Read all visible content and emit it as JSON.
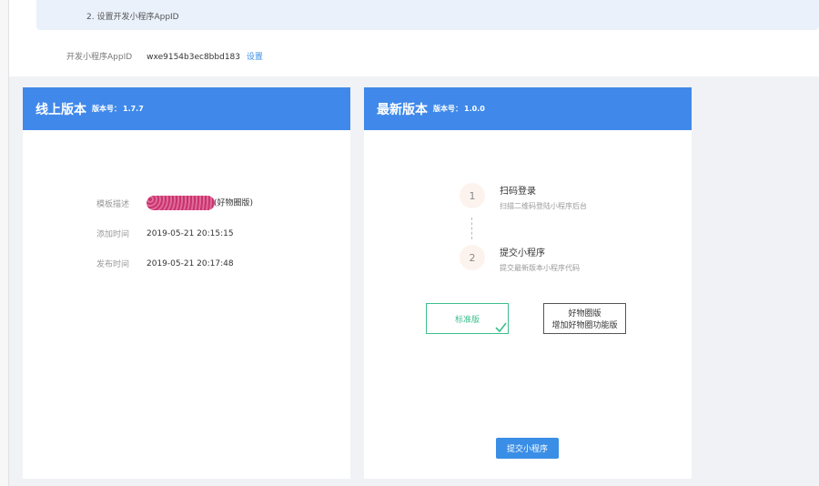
{
  "tip": {
    "text": "2. 设置开发小程序AppID"
  },
  "appid": {
    "label": "开发小程序AppID",
    "value": "wxe9154b3ec8bbd183",
    "link": "设置"
  },
  "online_card": {
    "title": "线上版本",
    "version_label": "版本号：",
    "version": "1.7.7",
    "rows": [
      {
        "label": "模板描述",
        "value": "(好物圈版)"
      },
      {
        "label": "添加时间",
        "value": "2019-05-21 20:15:15"
      },
      {
        "label": "发布时间",
        "value": "2019-05-21 20:17:48"
      }
    ]
  },
  "latest_card": {
    "title": "最新版本",
    "version_label": "版本号：",
    "version": "1.0.0",
    "steps": [
      {
        "number": "1",
        "title": "扫码登录",
        "desc": "扫描二维码登陆小程序后台"
      },
      {
        "number": "2",
        "title": "提交小程序",
        "desc": "提交最新版本小程序代码"
      }
    ],
    "versions": [
      {
        "name": "标准版",
        "desc": ""
      },
      {
        "name": "好物圈版",
        "desc": "增加好物圈功能版"
      }
    ],
    "submit_label": "提交小程序"
  },
  "colors": {
    "header": "#4089ea",
    "accent": "#3a8ee6",
    "selected": "#3cbf8c"
  }
}
